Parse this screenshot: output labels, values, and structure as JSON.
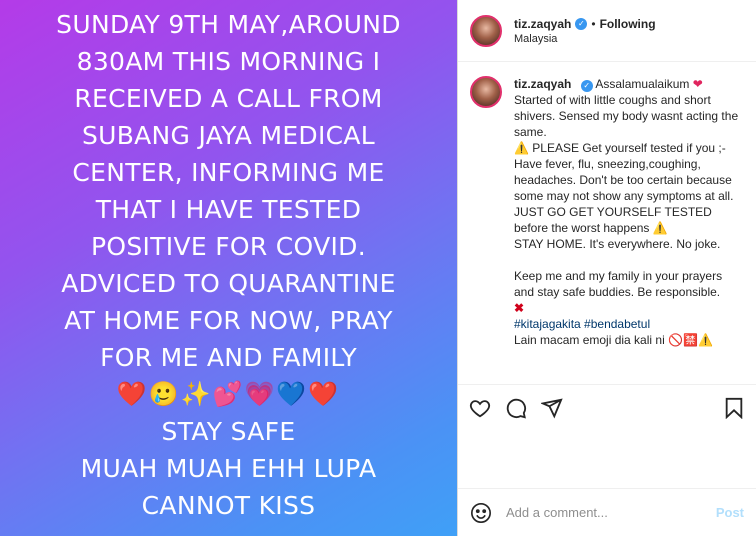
{
  "story": {
    "lines": [
      "SUNDAY 9TH MAY,AROUND",
      "830AM THIS MORNING I",
      "RECEIVED A CALL FROM",
      "SUBANG JAYA MEDICAL",
      "CENTER, INFORMING ME",
      "THAT I HAVE TESTED",
      "POSITIVE FOR COVID.",
      "ADVICED TO QUARANTINE",
      "AT HOME FOR NOW, PRAY",
      "FOR ME AND FAMILY"
    ],
    "emojis": "❤️🥲✨💕💗💙❤️",
    "lines_after": [
      "STAY SAFE",
      "MUAH MUAH EHH LUPA",
      "CANNOT KISS"
    ]
  },
  "header": {
    "username": "tiz.zaqyah",
    "follow_label": "Following",
    "location": "Malaysia"
  },
  "caption": {
    "username": "tiz.zaqyah",
    "p1": "Assalamualaikum",
    "p2": "Started of with little coughs and short shivers. Sensed my body wasnt acting the same.",
    "p3": "PLEASE Get yourself tested if you ;- Have fever, flu, sneezing,coughing, headaches. Don't be too certain because some may not show any symptoms at all. JUST GO GET YOURSELF TESTED before the worst happens",
    "p4": "STAY HOME. It's everywhere. No joke.",
    "p5": "Keep me and my family in your prayers and stay safe buddies. Be responsible.",
    "tags": "#kitajagakita #bendabetul",
    "last": "Lain macam emoji dia kali ni 🚫🈲⚠️"
  },
  "comment_box": {
    "placeholder": "Add a comment...",
    "post_label": "Post"
  },
  "icons": {
    "like": "heart-icon",
    "comment": "comment-icon",
    "share": "share-icon",
    "save": "bookmark-icon",
    "emoji": "smile-icon"
  },
  "colors": {
    "gradient_top": "#b43be8",
    "gradient_bottom": "#3fa0f7",
    "verified": "#3897f0",
    "post_disabled": "#b2dffc"
  }
}
